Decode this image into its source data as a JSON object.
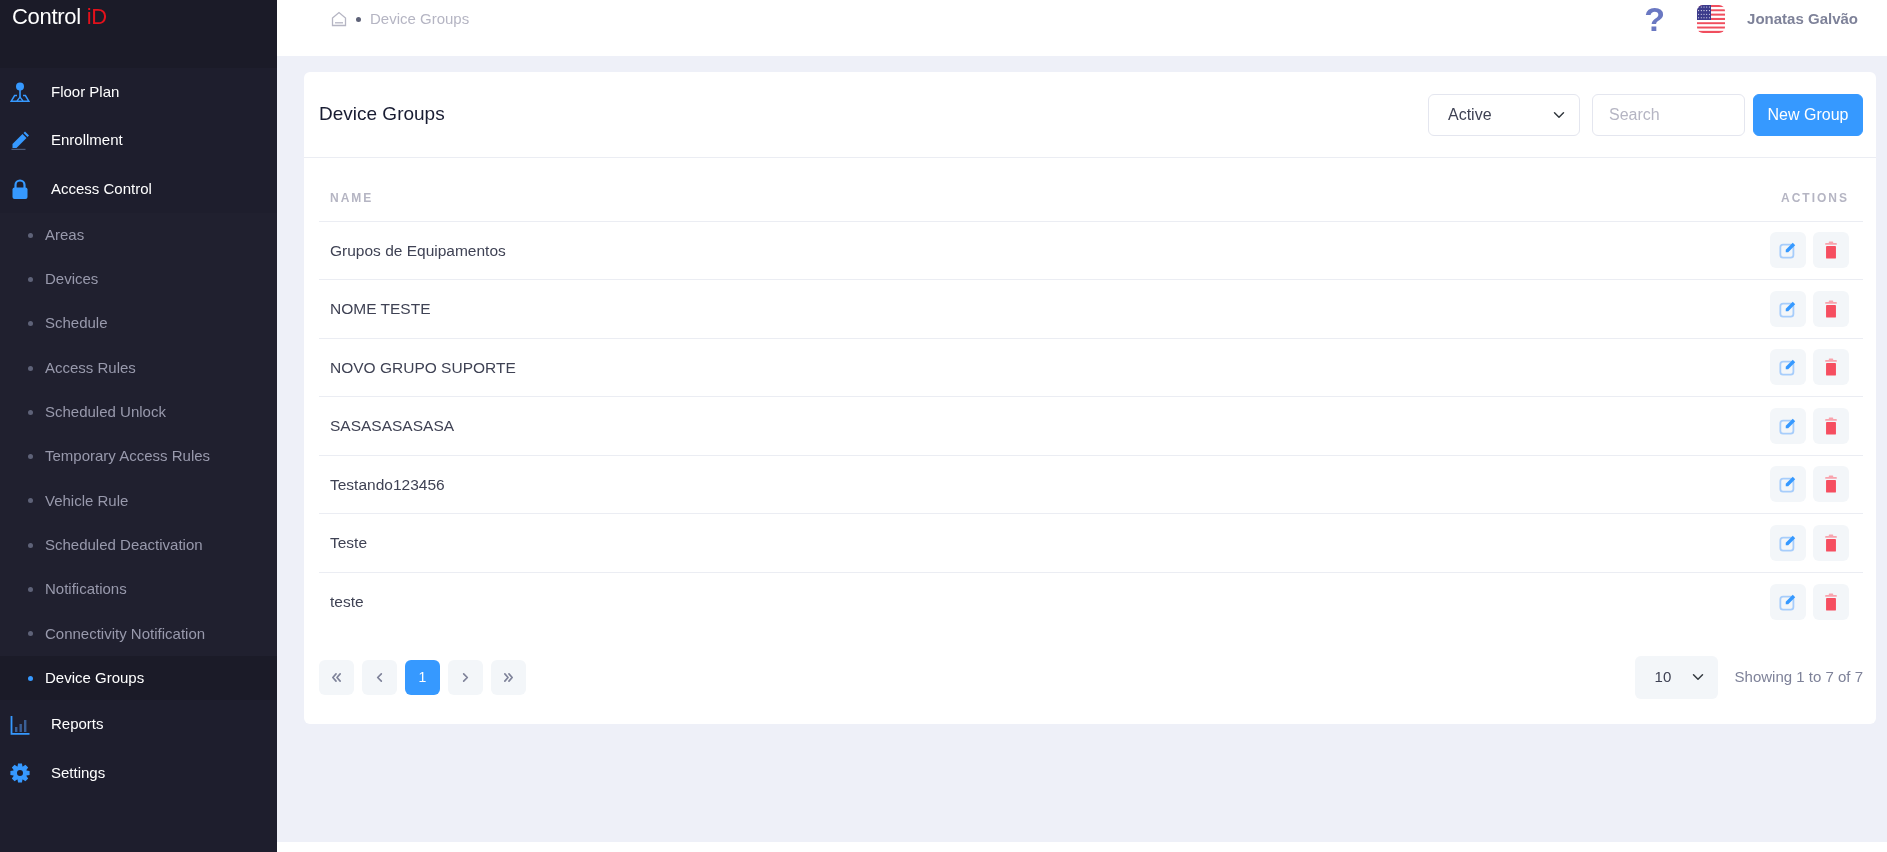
{
  "sidebar": {
    "logo": {
      "text": "Control",
      "accent": "iD"
    },
    "items": [
      {
        "label": "Floor Plan"
      },
      {
        "label": "Enrollment"
      },
      {
        "label": "Access Control",
        "children": [
          {
            "label": "Areas",
            "selected": false
          },
          {
            "label": "Devices",
            "selected": false
          },
          {
            "label": "Schedule",
            "selected": false
          },
          {
            "label": "Access Rules",
            "selected": false
          },
          {
            "label": "Scheduled Unlock",
            "selected": false
          },
          {
            "label": "Temporary Access Rules",
            "selected": false
          },
          {
            "label": "Vehicle Rule",
            "selected": false
          },
          {
            "label": "Scheduled Deactivation",
            "selected": false
          },
          {
            "label": "Notifications",
            "selected": false
          },
          {
            "label": "Connectivity Notification",
            "selected": false
          },
          {
            "label": "Device Groups",
            "selected": true
          }
        ]
      },
      {
        "label": "Reports"
      },
      {
        "label": "Settings"
      }
    ]
  },
  "top_bar": {
    "breadcrumb": [
      {
        "label": "Device Groups"
      }
    ],
    "help": "?",
    "user": "Jonatas Galvão"
  },
  "card": {
    "title": "Device Groups",
    "status_filter": "Active",
    "search": {
      "placeholder": "Search"
    },
    "new_button": "New Group"
  },
  "table": {
    "columns": [
      "NAME",
      "ACTIONS"
    ],
    "rows": [
      {
        "name": "Grupos de Equipamentos"
      },
      {
        "name": "NOME TESTE"
      },
      {
        "name": "NOVO GRUPO SUPORTE"
      },
      {
        "name": "SASASASASASA"
      },
      {
        "name": "Testando123456"
      },
      {
        "name": "Teste"
      },
      {
        "name": "teste"
      }
    ]
  },
  "pagination": {
    "pages": [
      {
        "label": "1",
        "selected": true
      }
    ],
    "page_size": "10",
    "summary": "Showing 1 to 7 of 7"
  }
}
